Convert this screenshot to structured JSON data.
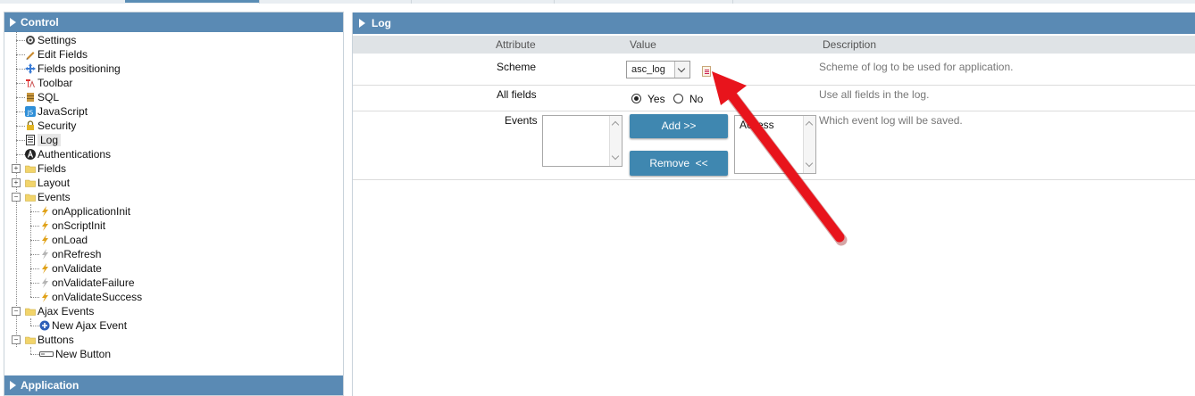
{
  "control_panel": {
    "title": "Control"
  },
  "application_panel": {
    "title": "Application"
  },
  "tree": {
    "settings": "Settings",
    "edit_fields": "Edit Fields",
    "fields_positioning": "Fields positioning",
    "toolbar": "Toolbar",
    "sql": "SQL",
    "javascript": "JavaScript",
    "security": "Security",
    "log": "Log",
    "authentications": "Authentications",
    "fields": "Fields",
    "layout": "Layout",
    "events": "Events",
    "event_items": [
      "onApplicationInit",
      "onScriptInit",
      "onLoad",
      "onRefresh",
      "onValidate",
      "onValidateFailure",
      "onValidateSuccess"
    ],
    "ajax_events": "Ajax Events",
    "new_ajax_event": "New Ajax Event",
    "buttons": "Buttons",
    "new_button": "New Button"
  },
  "log_panel": {
    "title": "Log",
    "columns": {
      "attribute": "Attribute",
      "value": "Value",
      "description": "Description"
    },
    "scheme": {
      "label": "Scheme",
      "value": "asc_log",
      "description": "Scheme of log to be used for application."
    },
    "all_fields": {
      "label": "All fields",
      "yes": "Yes",
      "no": "No",
      "selected": "Yes",
      "description": "Use all fields in the log."
    },
    "events": {
      "label": "Events",
      "add_button": "Add >>",
      "remove_button": "Remove  <<",
      "selected_items": [
        "Access"
      ],
      "description": "Which event log will be saved."
    }
  },
  "colors": {
    "header_bg": "#5a8ab4",
    "button_bg": "#3f87b0",
    "arrow": "#e8141c"
  }
}
